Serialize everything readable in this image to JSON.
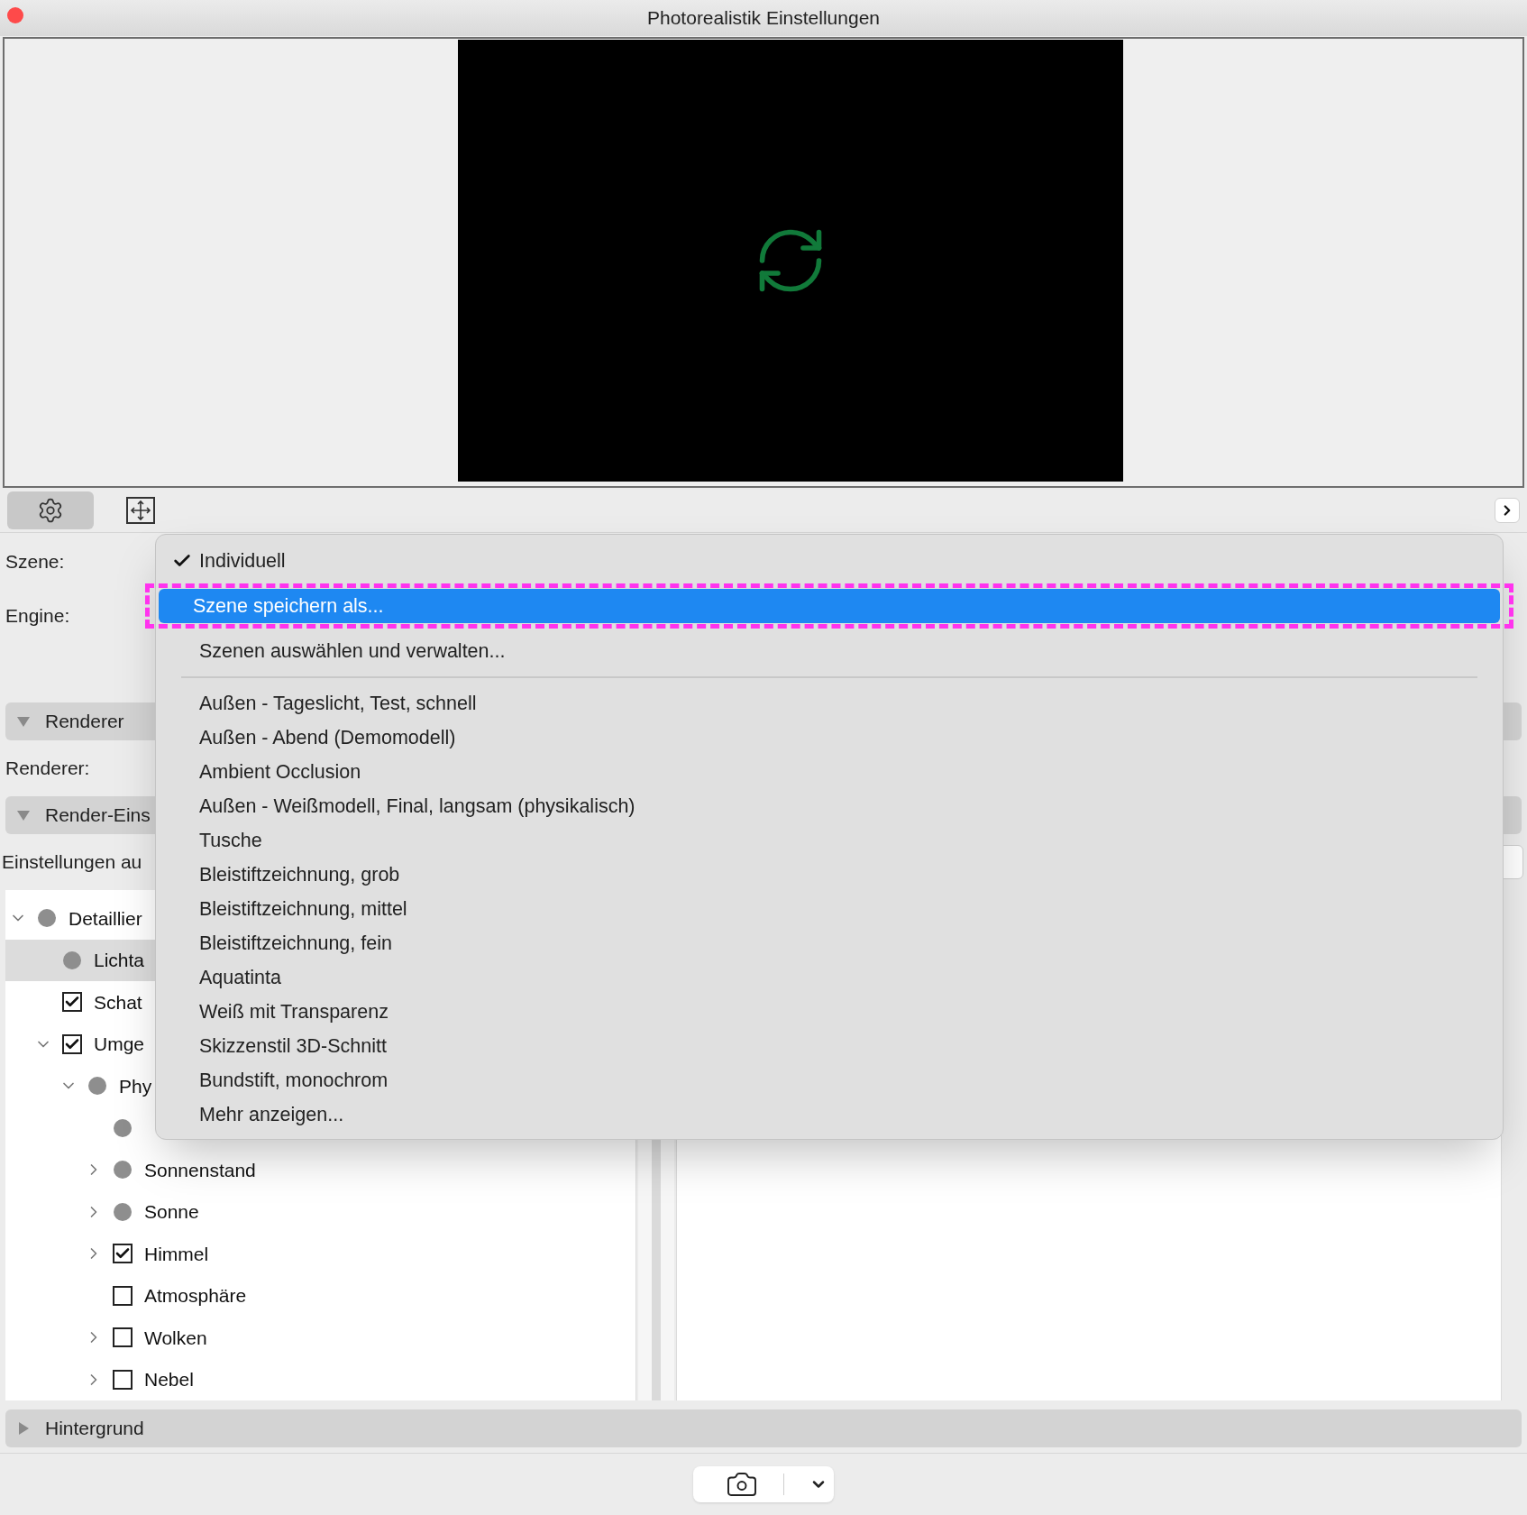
{
  "window": {
    "title": "Photorealistik Einstellungen"
  },
  "labels": {
    "scene": "Szene:",
    "engine": "Engine:",
    "renderer": "Renderer:",
    "settings": "Einstellungen au"
  },
  "sections": [
    {
      "label": "Renderer",
      "expanded": true
    },
    {
      "label": "Render-Eins",
      "expanded": true
    },
    {
      "label": "Hintergrund",
      "expanded": false
    }
  ],
  "tree": [
    {
      "label": "Detaillier",
      "kind": "dot",
      "expanded": true,
      "selected": false,
      "children": [
        {
          "label": "Lichta",
          "kind": "dot",
          "selected": true
        },
        {
          "label": "Schat",
          "kind": "checkbox",
          "checked": true,
          "selected": false
        },
        {
          "label": "Umge",
          "kind": "checkbox",
          "checked": true,
          "expanded": true,
          "selected": false,
          "children": [
            {
              "label": "Phy",
              "kind": "dot",
              "expanded": true,
              "selected": false,
              "children": [
                {
                  "kind": "dot",
                  "selected": false
                },
                {
                  "label": "Sonnenstand",
                  "kind": "dot",
                  "expanded": false,
                  "selected": false
                },
                {
                  "label": "Sonne",
                  "kind": "dot",
                  "expanded": false,
                  "selected": false
                },
                {
                  "label": "Himmel",
                  "kind": "checkbox",
                  "checked": true,
                  "expanded": false,
                  "selected": false
                },
                {
                  "label": "Atmosphäre",
                  "kind": "checkbox",
                  "checked": false,
                  "selected": false
                },
                {
                  "label": "Wolken",
                  "kind": "checkbox",
                  "checked": false,
                  "expanded": false,
                  "selected": false
                },
                {
                  "label": "Nebel",
                  "kind": "checkbox",
                  "checked": false,
                  "expanded": false,
                  "selected": false
                }
              ]
            }
          ]
        }
      ]
    }
  ],
  "menu": [
    {
      "kind": "item",
      "label": "Individuell",
      "checked": true,
      "selected": false
    },
    {
      "kind": "item",
      "label": "Szene speichern als...",
      "checked": false,
      "selected": true,
      "annotated": true
    },
    {
      "kind": "item",
      "label": "Szenen auswählen und verwalten...",
      "checked": false,
      "selected": false
    },
    {
      "kind": "separator"
    },
    {
      "kind": "item",
      "label": "Außen - Tageslicht, Test, schnell",
      "checked": false,
      "selected": false
    },
    {
      "kind": "item",
      "label": "Außen - Abend (Demomodell)",
      "checked": false,
      "selected": false
    },
    {
      "kind": "item",
      "label": "Ambient Occlusion",
      "checked": false,
      "selected": false
    },
    {
      "kind": "item",
      "label": "Außen - Weißmodell, Final, langsam (physikalisch)",
      "checked": false,
      "selected": false
    },
    {
      "kind": "item",
      "label": "Tusche",
      "checked": false,
      "selected": false
    },
    {
      "kind": "item",
      "label": "Bleistiftzeichnung, grob",
      "checked": false,
      "selected": false
    },
    {
      "kind": "item",
      "label": "Bleistiftzeichnung, mittel",
      "checked": false,
      "selected": false
    },
    {
      "kind": "item",
      "label": "Bleistiftzeichnung, fein",
      "checked": false,
      "selected": false
    },
    {
      "kind": "item",
      "label": "Aquatinta",
      "checked": false,
      "selected": false
    },
    {
      "kind": "item",
      "label": "Weiß mit Transparenz",
      "checked": false,
      "selected": false
    },
    {
      "kind": "item",
      "label": "Skizzenstil 3D-Schnitt",
      "checked": false,
      "selected": false
    },
    {
      "kind": "item",
      "label": "Bundstift, monochrom",
      "checked": false,
      "selected": false
    },
    {
      "kind": "item",
      "label": "Mehr anzeigen...",
      "checked": false,
      "selected": false
    }
  ]
}
